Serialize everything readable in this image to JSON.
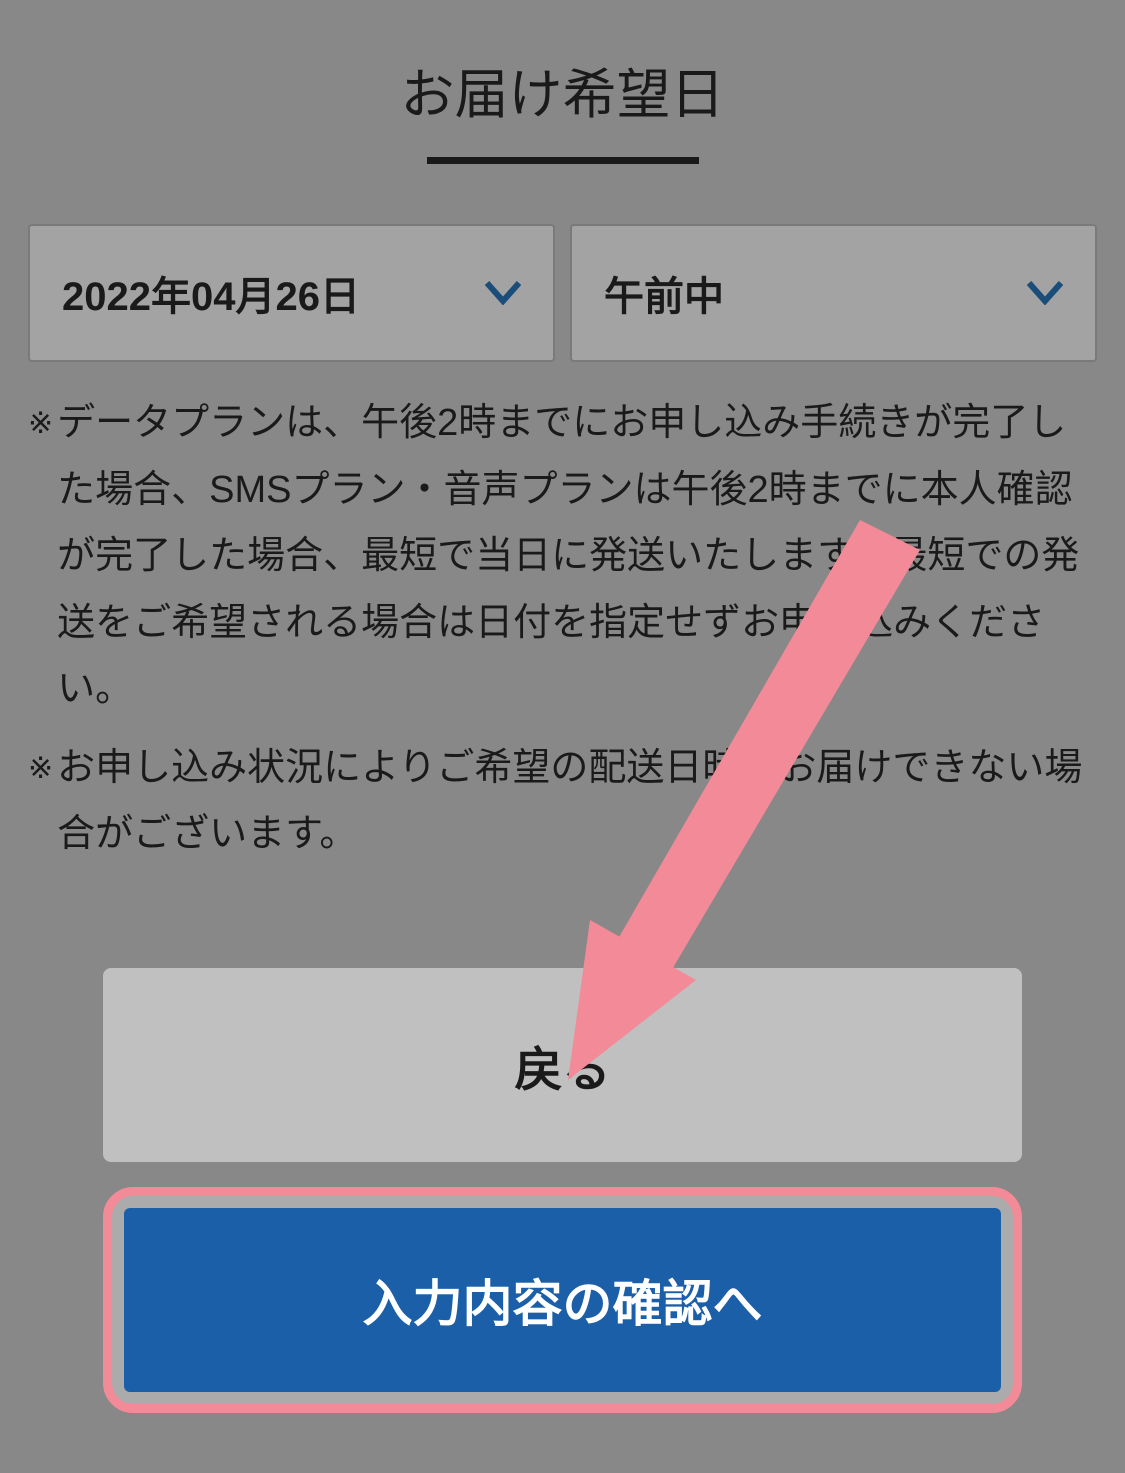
{
  "title": "お届け希望日",
  "date_select": {
    "value": "2022年04月26日"
  },
  "time_select": {
    "value": "午前中"
  },
  "notes": [
    "データプランは、午後2時までにお申し込み手続きが完了した場合、SMSプラン・音声プランは午後2時までに本人確認が完了した場合、最短で当日に発送いたします。最短での発送をご希望される場合は日付を指定せずお申し込みください。",
    "お申し込み状況によりご希望の配送日時にお届けできない場合がございます。"
  ],
  "buttons": {
    "back": "戻る",
    "confirm": "入力内容の確認へ"
  },
  "colors": {
    "chevron": "#1a4d7a",
    "arrow": "#f38a97"
  }
}
